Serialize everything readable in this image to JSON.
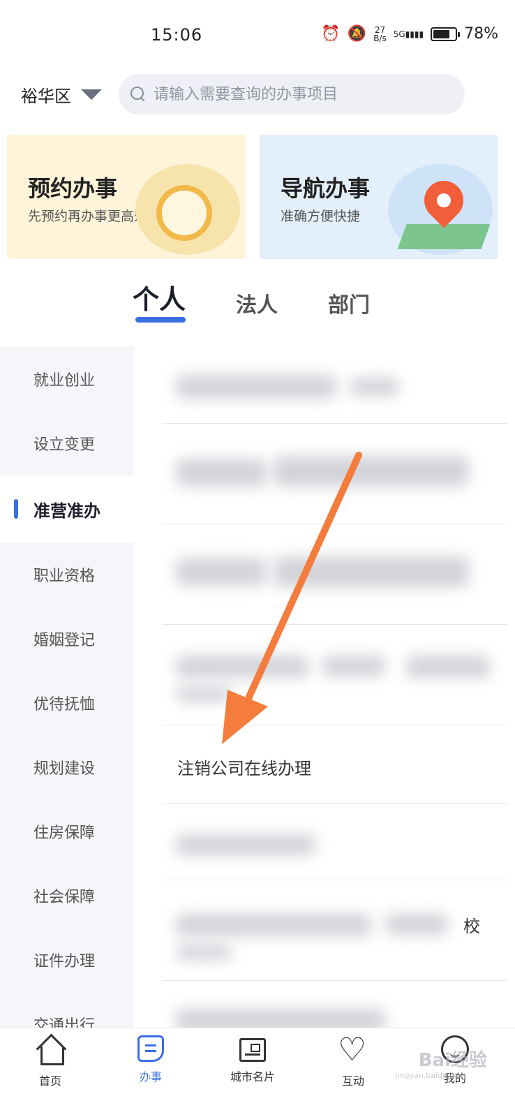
{
  "status_bar": {
    "time": "15:06",
    "net_speed_top": "27",
    "net_speed_bottom": "B/s",
    "signal": "5G",
    "battery": "78%",
    "battery_level": 0.78
  },
  "header": {
    "region": "裕华区",
    "search_placeholder": "请输入需要查询的办事项目"
  },
  "banners": [
    {
      "title": "预约办事",
      "subtitle": "先预约再办事更高效"
    },
    {
      "title": "导航办事",
      "subtitle": "准确方便快捷"
    }
  ],
  "tabs": [
    {
      "label": "个人",
      "active": true
    },
    {
      "label": "法人",
      "active": false
    },
    {
      "label": "部门",
      "active": false
    }
  ],
  "sidebar": {
    "items": [
      {
        "label": "就业创业"
      },
      {
        "label": "设立变更"
      },
      {
        "label": "准营准办",
        "active": true
      },
      {
        "label": "职业资格"
      },
      {
        "label": "婚姻登记"
      },
      {
        "label": "优待抚恤"
      },
      {
        "label": "规划建设"
      },
      {
        "label": "住房保障"
      },
      {
        "label": "社会保障"
      },
      {
        "label": "证件办理"
      },
      {
        "label": "交通出行"
      }
    ]
  },
  "list": {
    "visible_item": "注销公司在线办理",
    "partial_char": "校"
  },
  "bottom_nav": [
    {
      "label": "首页",
      "icon": "home-icon"
    },
    {
      "label": "办事",
      "icon": "document-icon",
      "active": true
    },
    {
      "label": "城市名片",
      "icon": "city-card-icon"
    },
    {
      "label": "互动",
      "icon": "heart-icon"
    },
    {
      "label": "我的",
      "icon": "profile-icon"
    }
  ],
  "watermark": {
    "text": "Bai经验",
    "sub": "jingyan.baidu.com"
  },
  "colors": {
    "accent": "#3b6ee3",
    "arrow": "#f47c3c",
    "banner_yellow": "#fdf4d9",
    "banner_blue": "#e4effc"
  }
}
